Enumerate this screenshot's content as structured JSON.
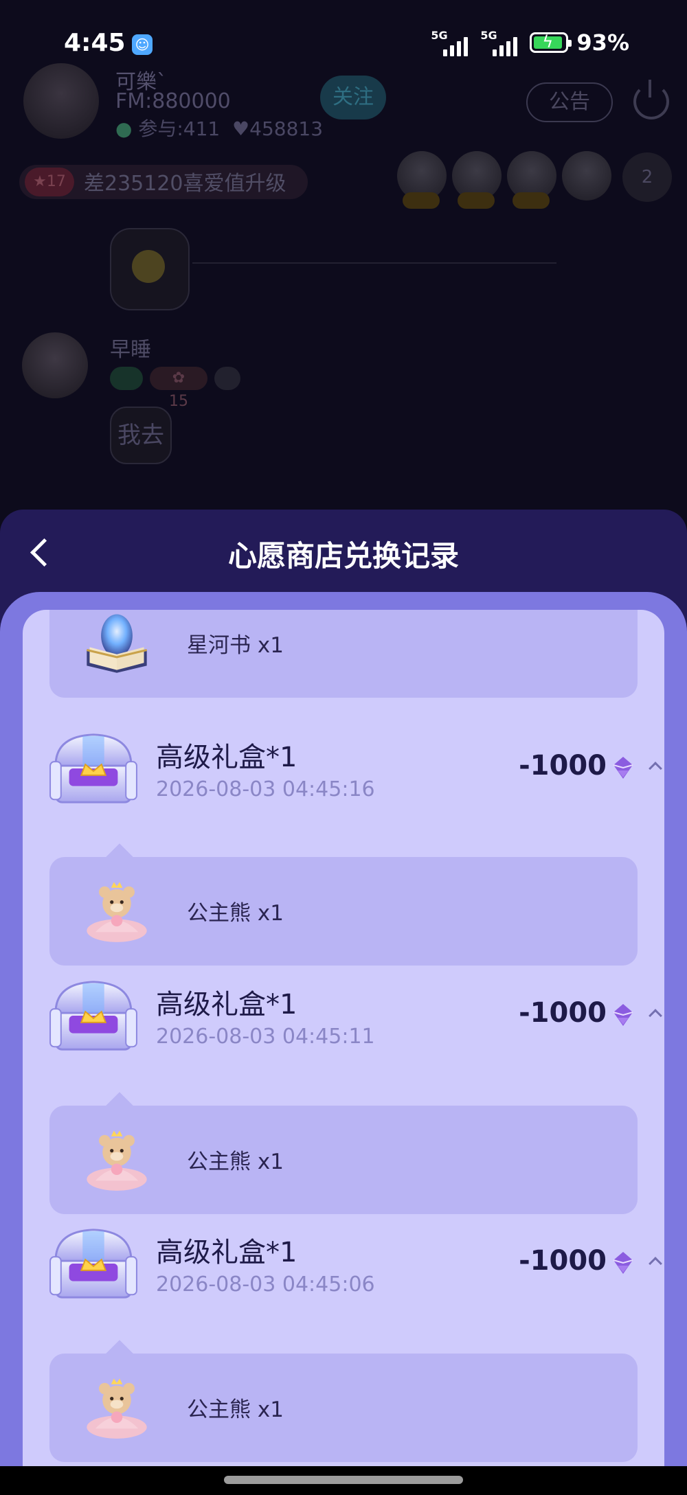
{
  "status_bar": {
    "time": "4:45",
    "network_1": "5G",
    "network_2": "5G",
    "battery_percent": "93%",
    "battery_level": 0.93,
    "battery_color": "#37d65a"
  },
  "background_room": {
    "host_name": "可樂`",
    "host_fm": "FM:880000",
    "host_participants": "参与:411",
    "host_hearts": "458813",
    "follow_label": "关注",
    "notice_label": "公告",
    "level_badge": "17",
    "level_text": "差235120喜爱值升级",
    "viewer_count": "2",
    "user2_name": "早睡",
    "user2_badge_level": "15",
    "message_text": "我去"
  },
  "sheet": {
    "title": "心愿商店兑换记录",
    "back_icon": "chevron-left-icon",
    "colors": {
      "frame": "#7d78e0",
      "panel": "#cfcbfc",
      "item_box": "#b9b4f4"
    },
    "partial_item": {
      "name": "星河书 x1",
      "icon": "galaxy-book-icon"
    },
    "records": [
      {
        "title": "高级礼盒*1",
        "date": "2026-08-03 04:45:16",
        "amount": "-1000",
        "currency_icon": "purple-gem-icon",
        "icon": "treasure-chest-icon",
        "item": {
          "name": "公主熊 x1",
          "icon": "princess-bear-icon"
        }
      },
      {
        "title": "高级礼盒*1",
        "date": "2026-08-03 04:45:11",
        "amount": "-1000",
        "currency_icon": "purple-gem-icon",
        "icon": "treasure-chest-icon",
        "item": {
          "name": "公主熊 x1",
          "icon": "princess-bear-icon"
        }
      },
      {
        "title": "高级礼盒*1",
        "date": "2026-08-03 04:45:06",
        "amount": "-1000",
        "currency_icon": "purple-gem-icon",
        "icon": "treasure-chest-icon",
        "item": {
          "name": "公主熊 x1",
          "icon": "princess-bear-icon"
        }
      }
    ]
  }
}
